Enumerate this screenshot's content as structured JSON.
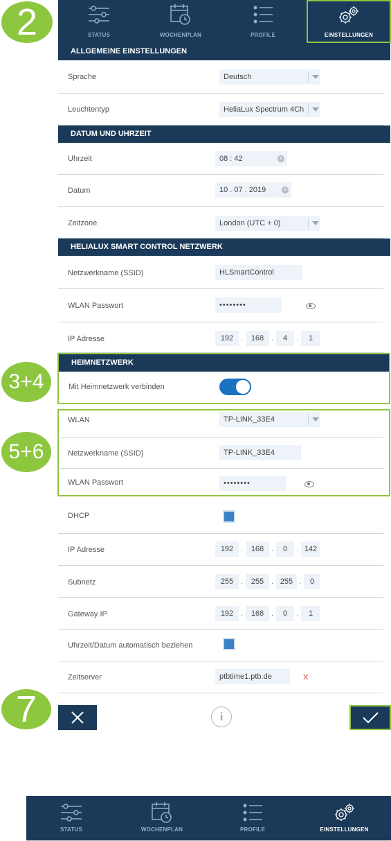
{
  "tabs": [
    {
      "label": "STATUS",
      "icon": "status-sliders-icon"
    },
    {
      "label": "WOCHENPLAN",
      "icon": "calendar-clock-icon"
    },
    {
      "label": "PROFILE",
      "icon": "profile-list-icon"
    },
    {
      "label": "EINSTELLUNGEN",
      "icon": "settings-gears-icon"
    }
  ],
  "badges": {
    "b2": "2",
    "b34": "3+4",
    "b56": "5+6",
    "b7": "7"
  },
  "sections": {
    "general": "ALLGEMEINE EINSTELLUNGEN",
    "datetime": "DATUM UND UHRZEIT",
    "network": "HELIALUX SMART CONTROL NETZWERK",
    "home": "HEIMNETZWERK"
  },
  "general": {
    "sprache_label": "Sprache",
    "sprache_value": "Deutsch",
    "leuchte_label": "Leuchtentyp",
    "leuchte_value": "HeliaLux Spectrum 4Ch"
  },
  "datetime": {
    "uhrzeit_label": "Uhrzeit",
    "uhrzeit_value": "08 : 42",
    "datum_label": "Datum",
    "datum_value": "10 . 07 . 2019",
    "zone_label": "Zeitzone",
    "zone_value": "London (UTC + 0)"
  },
  "network": {
    "ssid_label": "Netzwerkname (SSID)",
    "ssid_value": "HLSmartControl",
    "pw_label": "WLAN Passwort",
    "pw_value": "••••••••",
    "ip_label": "IP Adresse",
    "ip": [
      "192",
      "168",
      "4",
      "1"
    ]
  },
  "home": {
    "connect_label": "Mit Heimnetzwerk verbinden",
    "connect_on": true,
    "wlan_label": "WLAN",
    "wlan_value": "TP-LINK_33E4",
    "ssid_label": "Netzwerkname (SSID)",
    "ssid_value": "TP-LINK_33E4",
    "pw_label": "WLAN Passwort",
    "pw_value": "••••••••",
    "dhcp_label": "DHCP",
    "ip_label": "IP Adresse",
    "ip": [
      "192",
      "168",
      "0",
      "142"
    ],
    "subnet_label": "Subnetz",
    "subnet": [
      "255",
      "255",
      "255",
      "0"
    ],
    "gateway_label": "Gateway IP",
    "gateway": [
      "192",
      "168",
      "0",
      "1"
    ],
    "auto_label": "Uhrzeit/Datum automatisch beziehen",
    "server_label": "Zeitserver",
    "server_value": "ptbtime1.ptb.de",
    "server_clear": "X"
  },
  "bottom_tabs": [
    {
      "label": "STATUS"
    },
    {
      "label": "WOCHENPLAN"
    },
    {
      "label": "PROFILE"
    },
    {
      "label": "EINSTELLUNGEN"
    }
  ],
  "colors": {
    "navy": "#1b3a59",
    "accent_green": "#8dc63f",
    "toggle_blue": "#1a73c0"
  }
}
